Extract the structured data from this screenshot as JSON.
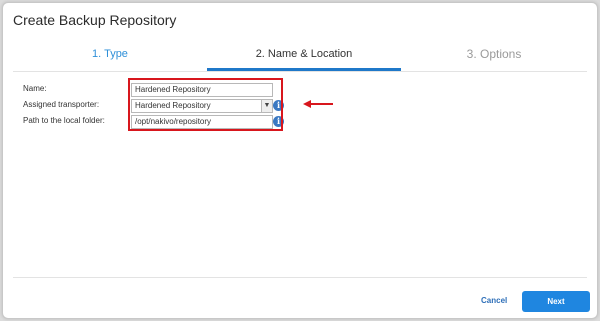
{
  "dialog": {
    "title": "Create Backup Repository"
  },
  "tabs": [
    {
      "label": "1. Type",
      "state": "completed"
    },
    {
      "label": "2. Name & Location",
      "state": "active"
    },
    {
      "label": "3. Options",
      "state": "upcoming"
    }
  ],
  "form": {
    "name": {
      "label": "Name:",
      "value": "Hardened Repository"
    },
    "transporter": {
      "label": "Assigned transporter:",
      "value": "Hardened Repository",
      "info_icon": "info-icon"
    },
    "path": {
      "label": "Path to the local folder:",
      "value": "/opt/nakivo/repository",
      "info_icon": "info-icon"
    }
  },
  "annotation": {
    "highlight_color": "#d8161d",
    "arrow": "left-arrow"
  },
  "footer": {
    "cancel_label": "Cancel",
    "next_label": "Next"
  },
  "colors": {
    "accent": "#1f78c9",
    "link": "#2e8fd8",
    "button": "#1f86e0"
  }
}
